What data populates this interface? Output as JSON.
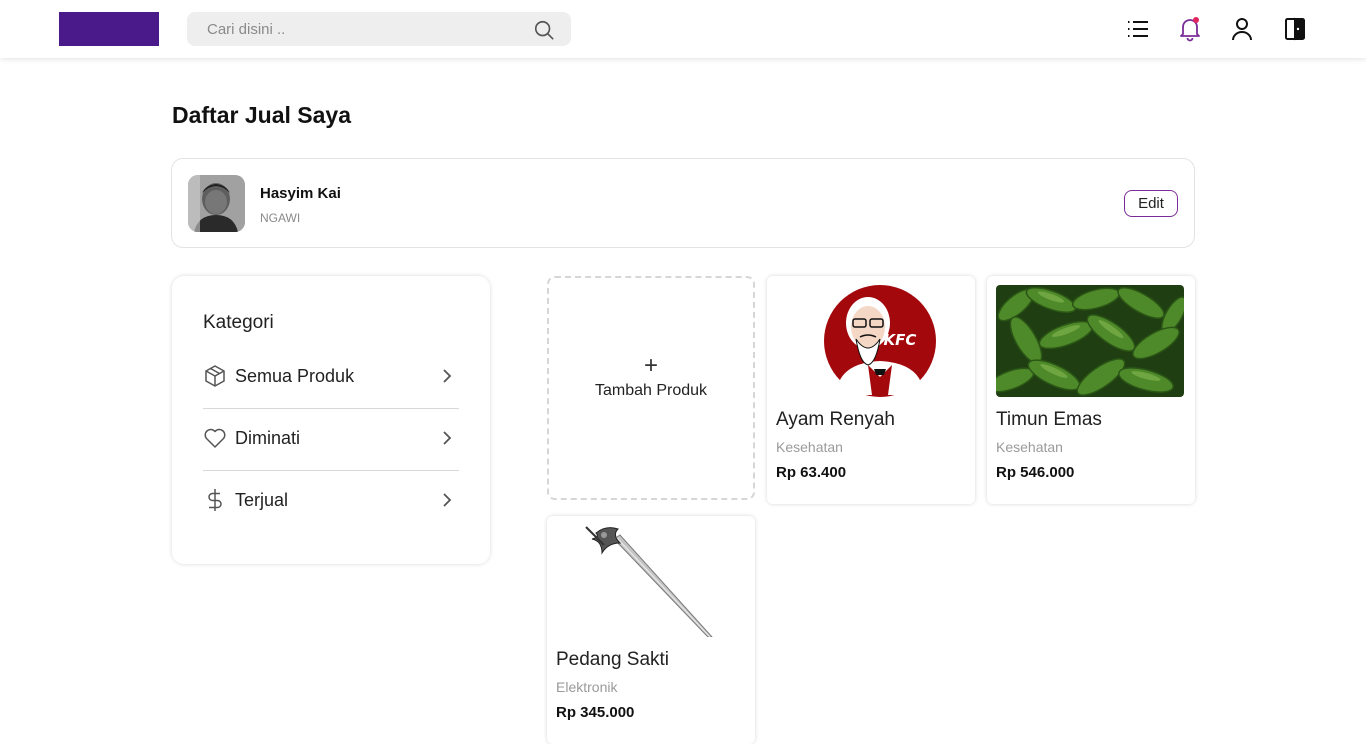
{
  "header": {
    "search_placeholder": "Cari disini ..",
    "icons": [
      "list-icon",
      "bell-icon",
      "user-icon",
      "logout-icon"
    ],
    "brand_color": "#4b1a8a",
    "notification_dot_color": "#e0245e"
  },
  "page": {
    "title": "Daftar Jual Saya"
  },
  "seller": {
    "name": "Hasyim Kai",
    "city": "NGAWI",
    "edit_label": "Edit"
  },
  "categories": {
    "title": "Kategori",
    "items": [
      {
        "label": "Semua Produk",
        "icon": "box-icon"
      },
      {
        "label": "Diminati",
        "icon": "heart-icon"
      },
      {
        "label": "Terjual",
        "icon": "dollar-icon"
      }
    ]
  },
  "add_product": {
    "symbol": "+",
    "label": "Tambah Produk"
  },
  "products": [
    {
      "name": "Ayam Renyah",
      "category": "Kesehatan",
      "price": "Rp 63.400",
      "image": "kfc-logo"
    },
    {
      "name": "Timun Emas",
      "category": "Kesehatan",
      "price": "Rp 546.000",
      "image": "cucumbers-photo"
    },
    {
      "name": "Pedang Sakti",
      "category": "Elektronik",
      "price": "Rp 345.000",
      "image": "sword-photo"
    }
  ]
}
